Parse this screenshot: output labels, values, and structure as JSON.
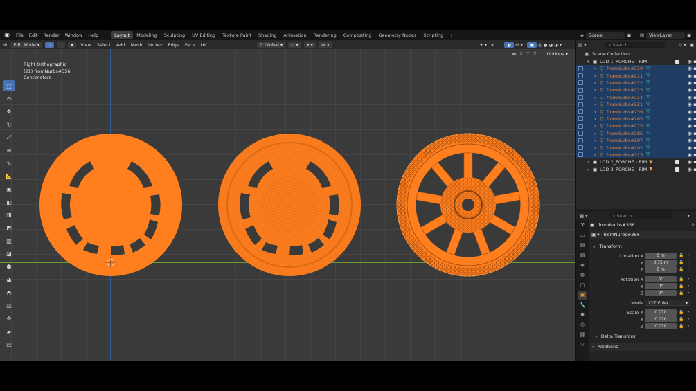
{
  "menu": {
    "items": [
      "File",
      "Edit",
      "Render",
      "Window",
      "Help"
    ]
  },
  "workspaces": {
    "tabs": [
      "Layout",
      "Modeling",
      "Sculpting",
      "UV Editing",
      "Texture Paint",
      "Shading",
      "Animation",
      "Rendering",
      "Compositing",
      "Geometry Nodes",
      "Scripting"
    ],
    "active": "Layout",
    "add": "+"
  },
  "scene": {
    "name": "Scene",
    "view_layer": "ViewLayer"
  },
  "viewport_header": {
    "mode": "Edit Mode",
    "menus": [
      "View",
      "Select",
      "Add",
      "Mesh",
      "Vertex",
      "Edge",
      "Face",
      "UV"
    ],
    "transform_orientation": "Global",
    "options": "Options",
    "axes": [
      "X",
      "Y",
      "Z"
    ]
  },
  "viewport": {
    "view_name": "Right Orthographic",
    "object_info": "(21) fromNurbs#356",
    "units": "Centimeters",
    "accent_color": "#ff7f1f"
  },
  "outliner": {
    "search_placeholder": "Search",
    "root": "Scene Collection",
    "collection": "LOD 1_PORCHE - RIM",
    "objects": [
      "fromNurbs#210",
      "fromNurbs#211",
      "fromNurbs#212",
      "fromNurbs#213",
      "fromNurbs#214",
      "fromNurbs#221",
      "fromNurbs#239",
      "fromNurbs#265",
      "fromNurbs#275",
      "fromNurbs#285",
      "fromNurbs#287",
      "fromNurbs#292",
      "fromNurbs#313"
    ],
    "other_collections": [
      "LOD 2_PORCHE - RIM",
      "LOD 3_PORCHE - RIM"
    ]
  },
  "properties": {
    "search_placeholder": "Search",
    "object_name": "fromNurbs#356",
    "data_name": "fromNurbs#356",
    "transform": {
      "title": "Transform",
      "location_label": "Location X",
      "location": {
        "x": "0 m",
        "y": "0.75 m",
        "z": "0 m"
      },
      "rotation_label": "Rotation X",
      "rotation": {
        "x": "0°",
        "y": "0°",
        "z": "0°"
      },
      "mode_label": "Mode",
      "mode": "XYZ Euler",
      "scale_label": "Scale X",
      "scale": {
        "x": "0.010",
        "y": "0.010",
        "z": "0.010"
      },
      "y_label": "Y",
      "z_label": "Z"
    },
    "delta_transform": "Delta Transform",
    "relations": "Relations"
  }
}
